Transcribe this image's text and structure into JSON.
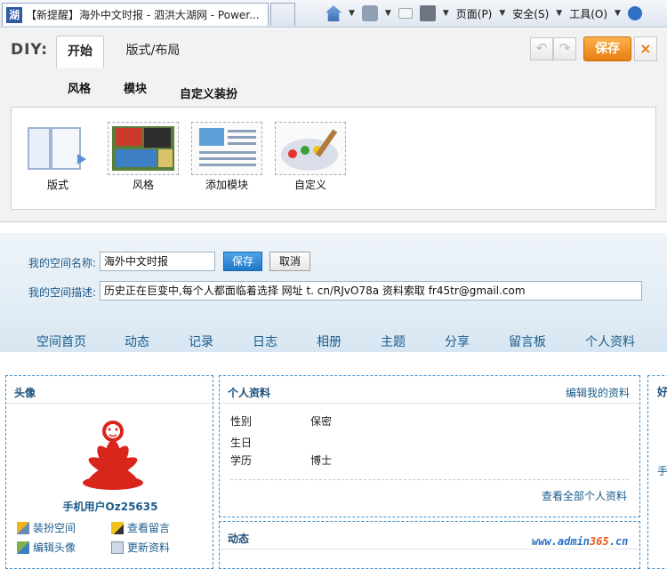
{
  "browser": {
    "tab_title": "【新提醒】海外中文时报 - 泗洪大湖网 - Power...",
    "favicon_text": "湖",
    "menus": {
      "page": "页面(P)",
      "safety": "安全(S)",
      "tools": "工具(O)"
    },
    "icons": [
      "home-icon",
      "rss-icon",
      "mail-icon",
      "print-icon",
      "help-icon"
    ],
    "colors": {
      "chrome": "#dfe6f0"
    }
  },
  "diy": {
    "logo": "DIY:",
    "tabs": {
      "start": "开始",
      "layout": "版式/布局"
    },
    "save_label": "保存",
    "close_label": "×",
    "undo_label": "↶",
    "redo_label": "↷",
    "subtabs": [
      "风格",
      "模块",
      "自定义装扮"
    ],
    "tools": [
      {
        "label": "版式",
        "icon": "layout-icon"
      },
      {
        "label": "风格",
        "icon": "style-icon"
      },
      {
        "label": "添加模块",
        "icon": "add-module-icon"
      },
      {
        "label": "自定义",
        "icon": "custom-palette-icon"
      }
    ],
    "colors": {
      "save": "#f0941f"
    }
  },
  "space": {
    "name_label": "我的空间名称:",
    "name_value": "海外中文时报",
    "save_button": "保存",
    "cancel_button": "取消",
    "desc_label": "我的空间描述:",
    "desc_value": "历史正在巨变中,每个人都面临着选择 网址 t. cn/RJvO78a 资料索取 fr45tr@gmail.com",
    "nav": [
      "空间首页",
      "动态",
      "记录",
      "日志",
      "相册",
      "主题",
      "分享",
      "留言板",
      "个人资料"
    ]
  },
  "avatar_box": {
    "title": "头像",
    "username": "手机用户Oz25635",
    "actions": [
      {
        "label": "装扮空间",
        "icon": "paint-brush-icon"
      },
      {
        "label": "查看留言",
        "icon": "pencil-icon"
      },
      {
        "label": "编辑头像",
        "icon": "edit-avatar-icon"
      },
      {
        "label": "更新资料",
        "icon": "profile-card-icon"
      }
    ]
  },
  "profile_box": {
    "title": "个人资料",
    "edit_link": "编辑我的资料",
    "rows": [
      {
        "key": "性别",
        "value": "保密"
      },
      {
        "key": "生日",
        "value": ""
      },
      {
        "key": "学历",
        "value": "博士"
      }
    ],
    "view_all": "查看全部个人资料"
  },
  "feed_box": {
    "title": "动态"
  },
  "right_box": {
    "title_fragment": "好",
    "text_fragment": "手"
  },
  "watermark": {
    "prefix": "www.admin",
    "num": "365",
    "suffix": ".cn"
  }
}
